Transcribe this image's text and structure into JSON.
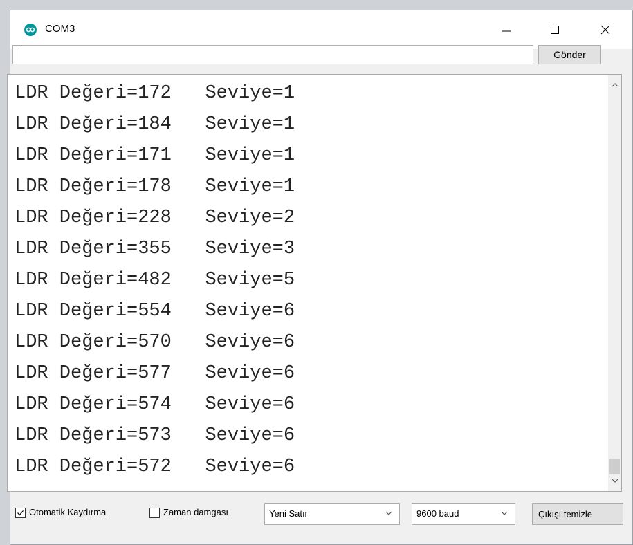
{
  "window": {
    "title": "COM3",
    "app_icon": "arduino-icon",
    "accent": "#00979c"
  },
  "send_bar": {
    "input_value": "",
    "send_label": "Gönder"
  },
  "output": {
    "lines": [
      "LDR Değeri=172   Seviye=1",
      "LDR Değeri=184   Seviye=1",
      "LDR Değeri=171   Seviye=1",
      "LDR Değeri=178   Seviye=1",
      "LDR Değeri=228   Seviye=2",
      "LDR Değeri=355   Seviye=3",
      "LDR Değeri=482   Seviye=5",
      "LDR Değeri=554   Seviye=6",
      "LDR Değeri=570   Seviye=6",
      "LDR Değeri=577   Seviye=6",
      "LDR Değeri=574   Seviye=6",
      "LDR Değeri=573   Seviye=6",
      "LDR Değeri=572   Seviye=6"
    ]
  },
  "status_bar": {
    "autoscroll_label": "Otomatik Kaydırma",
    "autoscroll_checked": true,
    "timestamp_label": "Zaman damgası",
    "timestamp_checked": false,
    "line_ending_value": "Yeni Satır",
    "baud_value": "9600 baud",
    "clear_label": "Çıkışı temizle"
  }
}
